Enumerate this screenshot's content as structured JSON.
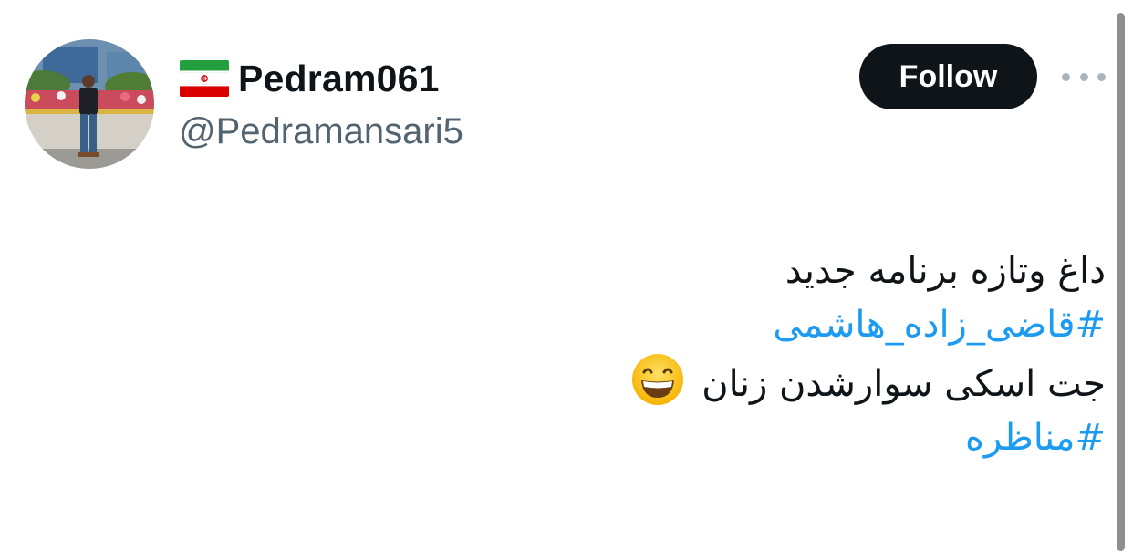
{
  "author": {
    "display_name": "Pedram061",
    "handle": "@Pedramansari5",
    "flag_icon": "iran-flag-icon",
    "avatar_icon": "avatar-photo"
  },
  "actions": {
    "follow_label": "Follow",
    "more_icon": "more-horizontal-icon"
  },
  "tweet": {
    "line1": "داغ وتازه برنامه جدید",
    "hashtag1": "#قاضی_زاده_هاشمی",
    "line3": "جت اسکی سوارشدن زنان",
    "emoji_icon": "grinning-face-emoji",
    "hashtag2": "#مناظره"
  },
  "colors": {
    "text": "#0f1419",
    "secondary_text": "#536471",
    "link": "#1d9bf0",
    "follow_bg": "#0f1419",
    "follow_text": "#ffffff"
  }
}
